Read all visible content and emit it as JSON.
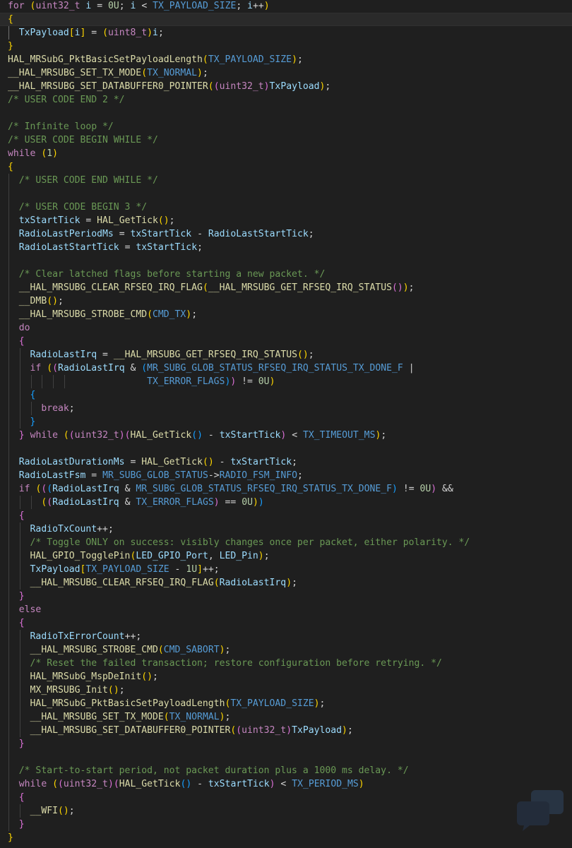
{
  "editor": {
    "language": "c",
    "current_line": 1,
    "colors": {
      "background": "#1f1f1f",
      "keyword": "#c586c0",
      "function": "#dcdcaa",
      "macro": "#569cd6",
      "variable": "#9cdcfe",
      "number": "#b5cea8",
      "comment": "#6a9955",
      "bracket_1": "#ffd700",
      "bracket_2": "#da70d6",
      "bracket_3": "#179fff"
    },
    "lines": [
      "for (uint32_t i = 0U; i < TX_PAYLOAD_SIZE; i++)",
      "{",
      "  TxPayload[i] = (uint8_t)i;",
      "}",
      "HAL_MRSubG_PktBasicSetPayloadLength(TX_PAYLOAD_SIZE);",
      "__HAL_MRSUBG_SET_TX_MODE(TX_NORMAL);",
      "__HAL_MRSUBG_SET_DATABUFFER0_POINTER((uint32_t)TxPayload);",
      "/* USER CODE END 2 */",
      "",
      "/* Infinite loop */",
      "/* USER CODE BEGIN WHILE */",
      "while (1)",
      "{",
      "  /* USER CODE END WHILE */",
      "",
      "  /* USER CODE BEGIN 3 */",
      "  txStartTick = HAL_GetTick();",
      "  RadioLastPeriodMs = txStartTick - RadioLastStartTick;",
      "  RadioLastStartTick = txStartTick;",
      "",
      "  /* Clear latched flags before starting a new packet. */",
      "  __HAL_MRSUBG_CLEAR_RFSEQ_IRQ_FLAG(__HAL_MRSUBG_GET_RFSEQ_IRQ_STATUS());",
      "  __DMB();",
      "  __HAL_MRSUBG_STROBE_CMD(CMD_TX);",
      "  do",
      "  {",
      "    RadioLastIrq = __HAL_MRSUBG_GET_RFSEQ_IRQ_STATUS();",
      "    if ((RadioLastIrq & (MR_SUBG_GLOB_STATUS_RFSEQ_IRQ_STATUS_TX_DONE_F |",
      "                         TX_ERROR_FLAGS)) != 0U)",
      "    {",
      "      break;",
      "    }",
      "  } while ((uint32_t)(HAL_GetTick() - txStartTick) < TX_TIMEOUT_MS);",
      "",
      "  RadioLastDurationMs = HAL_GetTick() - txStartTick;",
      "  RadioLastFsm = MR_SUBG_GLOB_STATUS->RADIO_FSM_INFO;",
      "  if (((RadioLastIrq & MR_SUBG_GLOB_STATUS_RFSEQ_IRQ_STATUS_TX_DONE_F) != 0U) &&",
      "      ((RadioLastIrq & TX_ERROR_FLAGS) == 0U))",
      "  {",
      "    RadioTxCount++;",
      "    /* Toggle ONLY on success: visibly changes once per packet, either polarity. */",
      "    HAL_GPIO_TogglePin(LED_GPIO_Port, LED_Pin);",
      "    TxPayload[TX_PAYLOAD_SIZE - 1U]++;",
      "    __HAL_MRSUBG_CLEAR_RFSEQ_IRQ_FLAG(RadioLastIrq);",
      "  }",
      "  else",
      "  {",
      "    RadioTxErrorCount++;",
      "    __HAL_MRSUBG_STROBE_CMD(CMD_SABORT);",
      "    /* Reset the failed transaction; restore configuration before retrying. */",
      "    HAL_MRSubG_MspDeInit();",
      "    MX_MRSUBG_Init();",
      "    HAL_MRSubG_PktBasicSetPayloadLength(TX_PAYLOAD_SIZE);",
      "    __HAL_MRSUBG_SET_TX_MODE(TX_NORMAL);",
      "    __HAL_MRSUBG_SET_DATABUFFER0_POINTER((uint32_t)TxPayload);",
      "  }",
      "",
      "  /* Start-to-start period, not packet duration plus a 1000 ms delay. */",
      "  while ((uint32_t)(HAL_GetTick() - txStartTick) < TX_PERIOD_MS)",
      "  {",
      "    __WFI();",
      "  }",
      "}"
    ]
  }
}
